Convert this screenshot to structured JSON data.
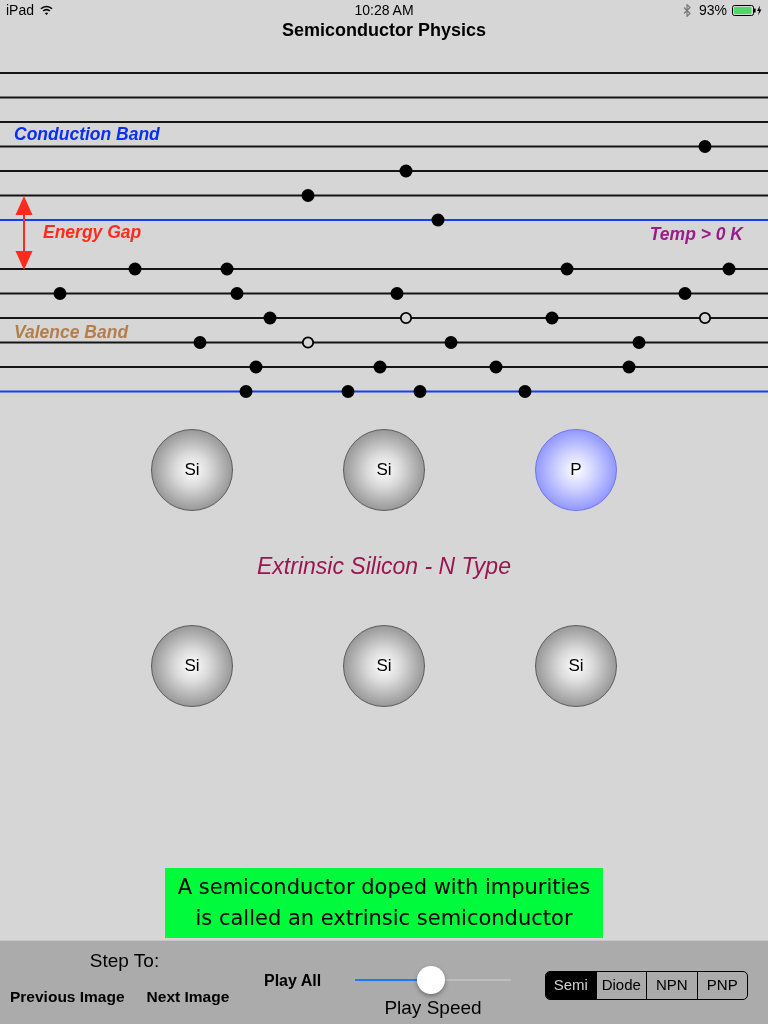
{
  "status_bar": {
    "device": "iPad",
    "time": "10:28 AM",
    "battery": "93%"
  },
  "title": "Semiconductor Physics",
  "band_diagram": {
    "conduction_band": {
      "label": "Conduction Band",
      "levels": [
        {
          "kind": "level"
        },
        {
          "kind": "level"
        },
        {
          "kind": "level"
        },
        {
          "kind": "level",
          "carriers": [
            {
              "kind": "electron"
            }
          ]
        },
        {
          "kind": "level",
          "carriers": [
            {
              "kind": "electron"
            }
          ]
        },
        {
          "kind": "level",
          "carriers": [
            {
              "kind": "electron"
            }
          ]
        },
        {
          "kind": "edge",
          "carriers": [
            {
              "kind": "electron"
            }
          ]
        }
      ]
    },
    "energy_gap": {
      "label": "Energy Gap"
    },
    "temperature": "Temp > 0 K",
    "valence_band": {
      "label": "Valence Band",
      "levels": [
        {
          "kind": "level",
          "carriers": [
            {
              "kind": "electron"
            },
            {
              "kind": "electron"
            },
            {
              "kind": "electron"
            },
            {
              "kind": "electron"
            }
          ]
        },
        {
          "kind": "level",
          "carriers": [
            {
              "kind": "electron"
            },
            {
              "kind": "electron"
            },
            {
              "kind": "electron"
            },
            {
              "kind": "electron"
            }
          ]
        },
        {
          "kind": "level",
          "carriers": [
            {
              "kind": "electron"
            },
            {
              "kind": "hole"
            },
            {
              "kind": "electron"
            },
            {
              "kind": "hole"
            }
          ]
        },
        {
          "kind": "level",
          "carriers": [
            {
              "kind": "electron"
            },
            {
              "kind": "hole"
            },
            {
              "kind": "electron"
            },
            {
              "kind": "electron"
            }
          ]
        },
        {
          "kind": "level",
          "carriers": [
            {
              "kind": "electron"
            },
            {
              "kind": "electron"
            },
            {
              "kind": "electron"
            },
            {
              "kind": "electron"
            }
          ]
        },
        {
          "kind": "edge",
          "carriers": [
            {
              "kind": "electron"
            },
            {
              "kind": "electron"
            },
            {
              "kind": "electron"
            },
            {
              "kind": "electron"
            }
          ]
        }
      ]
    }
  },
  "lattice": {
    "top_row": [
      {
        "symbol": "Si",
        "kind": "host"
      },
      {
        "symbol": "Si",
        "kind": "host"
      },
      {
        "symbol": "P",
        "kind": "dopant"
      }
    ],
    "caption": "Extrinsic Silicon - N Type",
    "bottom_row": [
      {
        "symbol": "Si",
        "kind": "host"
      },
      {
        "symbol": "Si",
        "kind": "host"
      },
      {
        "symbol": "Si",
        "kind": "host"
      }
    ]
  },
  "message": "A semiconductor doped with impurities\nis called an extrinsic semiconductor",
  "toolbar": {
    "step_label": "Step To:",
    "buttons": [
      "Previous Image",
      "Next Image"
    ],
    "play_all": "Play All",
    "speed": {
      "label": "Play Speed",
      "level": 0.49
    },
    "segments": [
      {
        "label": "Semi",
        "selected": true
      },
      {
        "label": "Diode",
        "selected": false
      },
      {
        "label": "NPN",
        "selected": false
      },
      {
        "label": "PNP",
        "selected": false
      }
    ]
  }
}
